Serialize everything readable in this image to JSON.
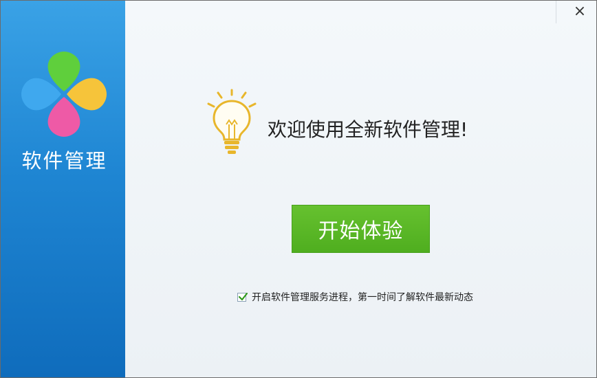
{
  "sidebar": {
    "title": "软件管理",
    "logo_icon": "four-petal-logo-icon"
  },
  "titlebar": {
    "close_glyph": "×",
    "close_icon": "close-icon"
  },
  "main": {
    "welcome_text": "欢迎使用全新软件管理!",
    "bulb_icon": "lightbulb-icon",
    "start_button_label": "开始体验",
    "option": {
      "checked": true,
      "label": "开启软件管理服务进程，第一时间了解软件最新动态"
    }
  },
  "colors": {
    "sidebar_top": "#3aa2e6",
    "sidebar_bottom": "#0f6cbc",
    "button_green": "#5bb828",
    "bulb_yellow": "#e8b62b"
  }
}
